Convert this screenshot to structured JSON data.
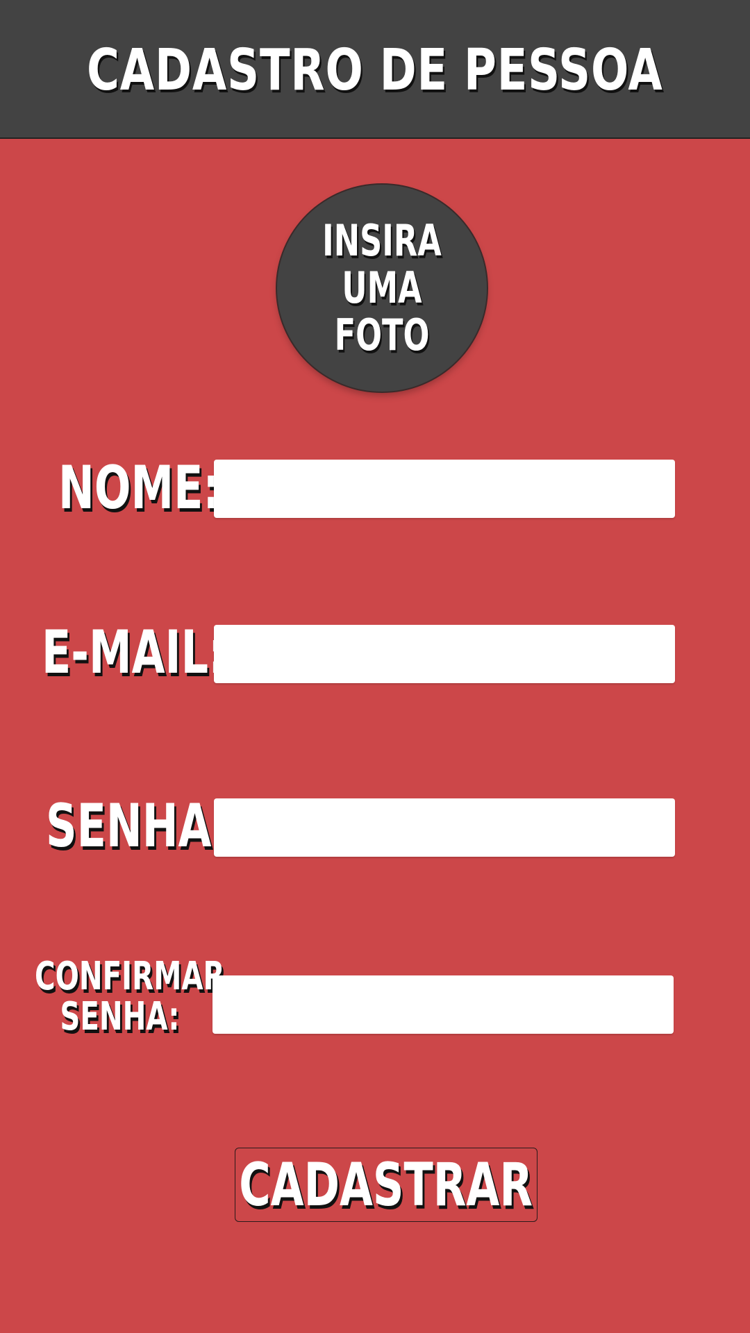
{
  "header": {
    "title": "CADASTRO DE PESSOA"
  },
  "photo": {
    "label": "INSIRA UMA FOTO"
  },
  "form": {
    "nome_label": "NOME:",
    "nome_value": "",
    "email_label": "E-MAIL:",
    "email_value": "",
    "senha_label": "SENHA:",
    "senha_value": "",
    "confirmar_label_line1": "CONFIRMAR",
    "confirmar_label_line2": "SENHA:",
    "confirmar_value": ""
  },
  "actions": {
    "submit_label": "CADASTRAR"
  },
  "colors": {
    "background": "#cc4749",
    "header": "#434343",
    "field": "#ffffff",
    "text": "#ffffff"
  }
}
